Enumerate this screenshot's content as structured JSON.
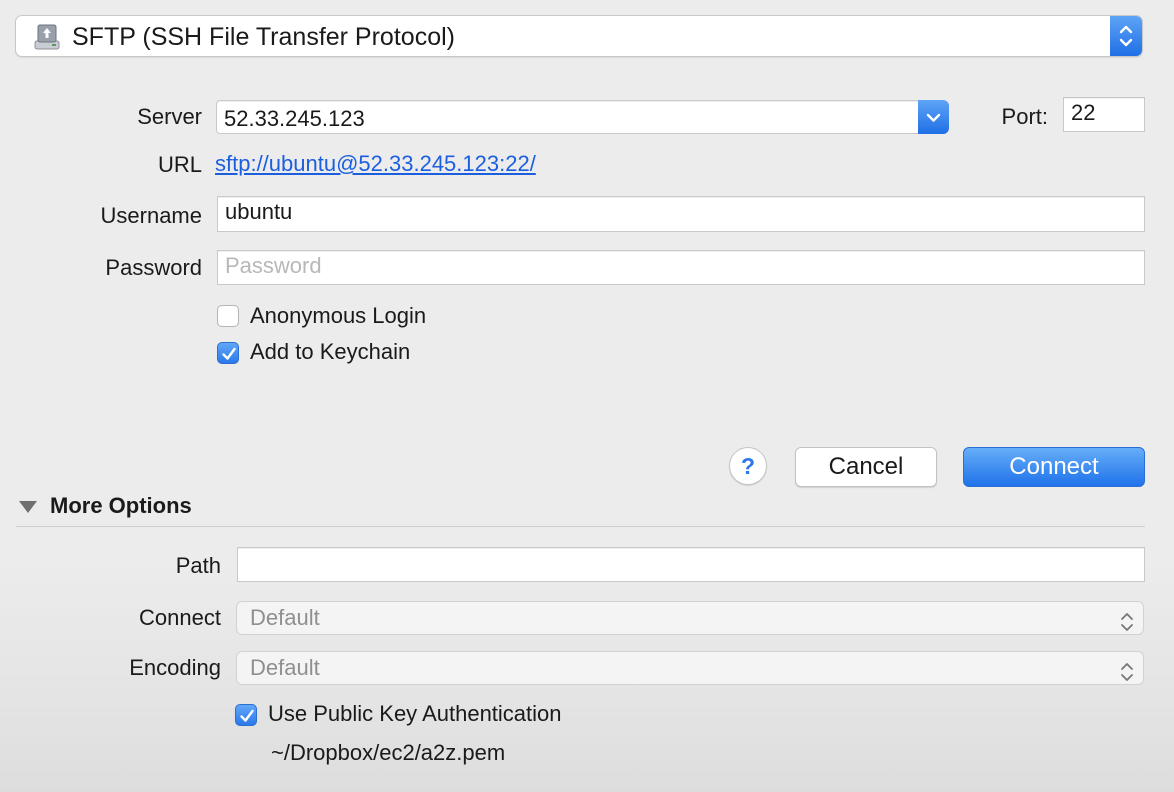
{
  "protocol": {
    "label": "SFTP (SSH File Transfer Protocol)",
    "icon": "drive-icon"
  },
  "server": {
    "label": "Server",
    "value": "52.33.245.123"
  },
  "port": {
    "label": "Port:",
    "value": "22"
  },
  "url": {
    "label": "URL",
    "value": "sftp://ubuntu@52.33.245.123:22/"
  },
  "username": {
    "label": "Username",
    "value": "ubuntu"
  },
  "password": {
    "label": "Password",
    "value": "",
    "placeholder": "Password"
  },
  "anonymous_login": {
    "label": "Anonymous Login",
    "checked": false
  },
  "add_to_keychain": {
    "label": "Add to Keychain",
    "checked": true
  },
  "buttons": {
    "help": "?",
    "cancel": "Cancel",
    "connect": "Connect"
  },
  "more_options": {
    "title": "More Options",
    "expanded": true,
    "path": {
      "label": "Path",
      "value": ""
    },
    "connect_mode": {
      "label": "Connect",
      "value": "Default"
    },
    "encoding": {
      "label": "Encoding",
      "value": "Default"
    },
    "public_key": {
      "label": "Use Public Key Authentication",
      "checked": true,
      "file": "~/Dropbox/ec2/a2z.pem"
    }
  },
  "colors": {
    "accent": "#2a78ea",
    "link": "#1b5fe0"
  }
}
